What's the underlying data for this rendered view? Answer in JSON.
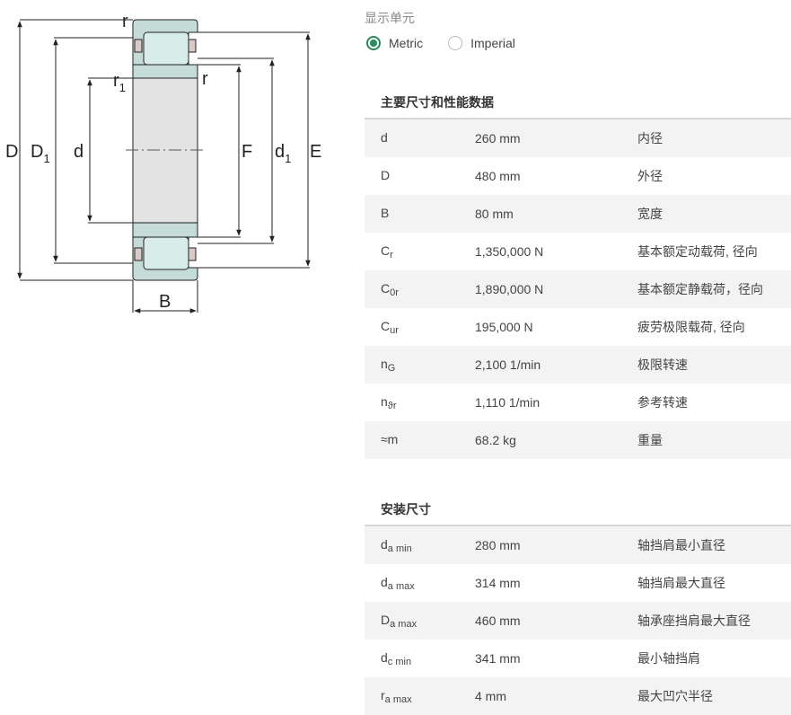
{
  "diagram": {
    "labels": {
      "D": "D",
      "D1": "D",
      "D1_sub": "1",
      "d": "d",
      "F": "F",
      "d1": "d",
      "d1_sub": "1",
      "E": "E",
      "r_top": "r",
      "r1": "r",
      "r1_sub": "1",
      "r_right": "r",
      "B": "B"
    },
    "colors": {
      "ring": "#c5dbd7",
      "core": "#e3e3e3",
      "roller": "#d8ece8",
      "cage": "#d9c9c9"
    }
  },
  "units": {
    "label": "显示单元",
    "options": [
      {
        "label": "Metric",
        "checked": true
      },
      {
        "label": "Imperial",
        "checked": false
      }
    ]
  },
  "main_dims": {
    "title": "主要尺寸和性能数据",
    "rows": [
      {
        "sym": "d",
        "sub": "",
        "value": "260 mm",
        "desc": "内径"
      },
      {
        "sym": "D",
        "sub": "",
        "value": "480 mm",
        "desc": "外径"
      },
      {
        "sym": "B",
        "sub": "",
        "value": "80 mm",
        "desc": "宽度"
      },
      {
        "sym": "C",
        "sub": "r",
        "value": "1,350,000 N",
        "desc": "基本额定动载荷, 径向"
      },
      {
        "sym": "C",
        "sub": "0r",
        "value": "1,890,000 N",
        "desc": "基本额定静载荷，径向"
      },
      {
        "sym": "C",
        "sub": "ur",
        "value": "195,000 N",
        "desc": "疲劳极限载荷, 径向"
      },
      {
        "sym": "n",
        "sub": "G",
        "value": "2,100 1/min",
        "desc": "极限转速"
      },
      {
        "sym": "n",
        "sub": "ϑr",
        "value": "1,110 1/min",
        "desc": "参考转速"
      },
      {
        "sym": "≈m",
        "sub": "",
        "value": "68.2 kg",
        "desc": "重量"
      }
    ]
  },
  "mount_dims": {
    "title": "安装尺寸",
    "rows": [
      {
        "sym": "d",
        "sub": "a min",
        "value": "280 mm",
        "desc": "轴挡肩最小直径"
      },
      {
        "sym": "d",
        "sub": "a max",
        "value": "314 mm",
        "desc": "轴挡肩最大直径"
      },
      {
        "sym": "D",
        "sub": "a max",
        "value": "460 mm",
        "desc": "轴承座挡肩最大直径"
      },
      {
        "sym": "d",
        "sub": "c min",
        "value": "341 mm",
        "desc": "最小轴挡肩"
      },
      {
        "sym": "r",
        "sub": "a max",
        "value": "4 mm",
        "desc": "最大凹穴半径"
      }
    ]
  }
}
